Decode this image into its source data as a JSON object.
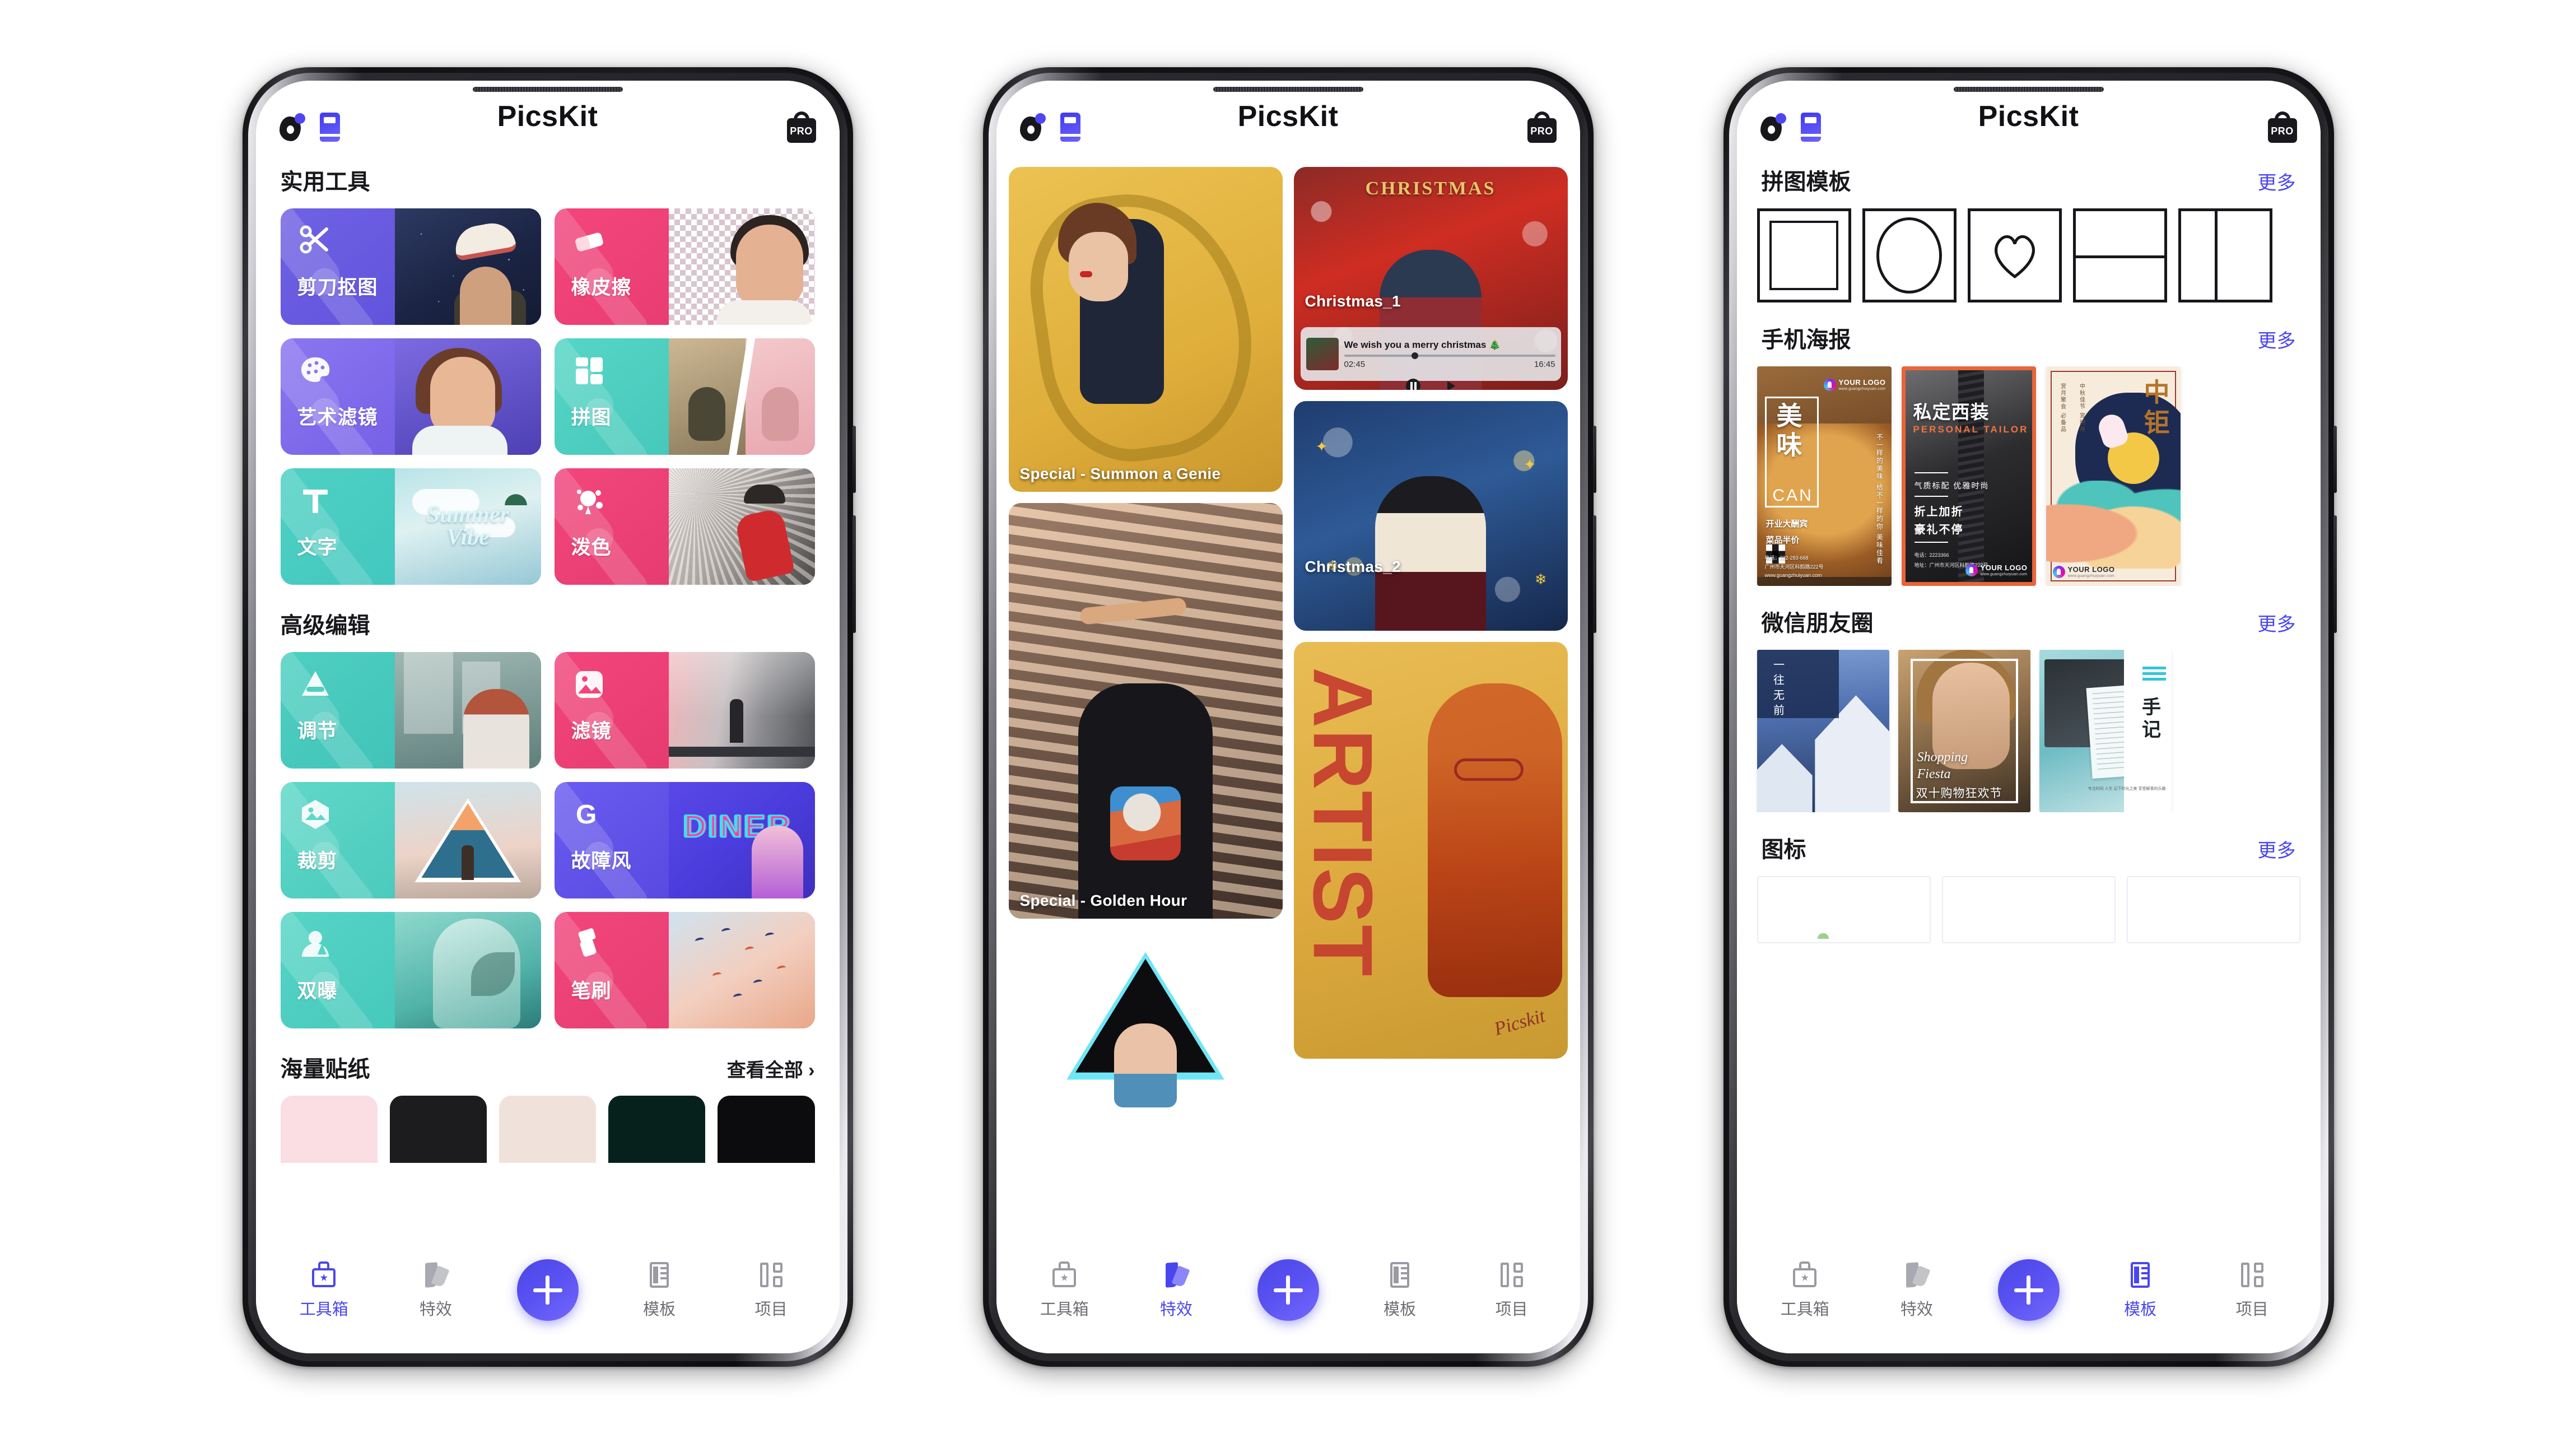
{
  "app": {
    "title": "PicsKit",
    "pro_badge": "PRO",
    "avatar_icon": "avatar-icon",
    "book_icon": "book-icon",
    "bag_icon": "pro-bag-icon"
  },
  "tabs": [
    {
      "label": "工具箱",
      "icon": "toolbox-icon"
    },
    {
      "label": "特效",
      "icon": "effects-icon"
    },
    {
      "label": "模板",
      "icon": "template-icon"
    },
    {
      "label": "项目",
      "icon": "project-icon"
    }
  ],
  "fab": {
    "icon": "plus-icon",
    "label": "+"
  },
  "colors": {
    "accent": "#4a46ef",
    "accent_light": "#7468fb",
    "pink": "#ef3f74",
    "teal": "#4ecdc0",
    "purple": "#7c6ae0",
    "text": "#18181c",
    "muted": "#6e6e76"
  },
  "phone1": {
    "active_tab": "工具箱",
    "sections": [
      {
        "title": "实用工具",
        "more": "",
        "cards": [
          {
            "label": "剪刀抠图",
            "icon": "scissors-icon",
            "theme": "purple"
          },
          {
            "label": "橡皮擦",
            "icon": "eraser-icon",
            "theme": "pink"
          },
          {
            "label": "艺术滤镜",
            "icon": "palette-icon",
            "theme": "purple"
          },
          {
            "label": "拼图",
            "icon": "grid-icon",
            "theme": "teal"
          },
          {
            "label": "文字",
            "icon": "text-t-icon",
            "theme": "teal"
          },
          {
            "label": "泼色",
            "icon": "splash-icon",
            "theme": "pink"
          }
        ]
      },
      {
        "title": "高级编辑",
        "more": "",
        "cards": [
          {
            "label": "调节",
            "icon": "adjust-icon",
            "theme": "teal"
          },
          {
            "label": "滤镜",
            "icon": "filter-icon",
            "theme": "pink"
          },
          {
            "label": "裁剪",
            "icon": "crop-icon",
            "theme": "teal"
          },
          {
            "label": "故障风",
            "icon": "glitch-g-icon",
            "theme": "indigo"
          },
          {
            "label": "双曝",
            "icon": "doubleexp-icon",
            "theme": "teal"
          },
          {
            "label": "笔刷",
            "icon": "brush-icon",
            "theme": "pink"
          }
        ]
      },
      {
        "title": "海量贴纸",
        "more": "查看全部 ›",
        "cards": []
      }
    ],
    "summer_vibe_line1": "Summer",
    "summer_vibe_line2": "Vibe",
    "glitch_neon_word": "DINER"
  },
  "phone2": {
    "active_tab": "特效",
    "cards": [
      {
        "caption": "Special - Summon a Genie",
        "col": 1
      },
      {
        "caption": "Christmas_1",
        "col": 2
      },
      {
        "caption": "Christmas_2",
        "col": 2
      },
      {
        "caption": "Special - Golden Hour",
        "col": 1
      },
      {
        "caption": "",
        "col": 1
      },
      {
        "caption": "",
        "col": 2
      }
    ],
    "christmas_banner": "CHRISTMAS",
    "player": {
      "track_title": "We wish you a merry christmas 🎄",
      "elapsed": "02:45",
      "duration": "16:45",
      "pause_icon": "pause-icon",
      "forward_icon": "fast-forward-icon"
    },
    "artist_word": "ARTIST",
    "artist_signature": "Picskit"
  },
  "phone3": {
    "active_tab": "模板",
    "sections": [
      {
        "title": "拼图模板",
        "more": "更多",
        "items": [
          {
            "shape": "rectangle"
          },
          {
            "shape": "oval"
          },
          {
            "shape": "heart"
          },
          {
            "shape": "h-split"
          },
          {
            "shape": "v-split"
          }
        ]
      },
      {
        "title": "手机海报",
        "more": "更多",
        "posters": [
          {
            "name": "food-poster",
            "headline": "美味",
            "sub": "CAN",
            "side_text": "不一样的美味 给不一样的你 美味佳肴",
            "promo_line1": "开业大酬宾",
            "promo_line2": "菜品半价",
            "logo": "YOUR LOGO",
            "logo_url": "www.guangzhuiyuan.com",
            "phone": "电话：222-283-668",
            "address": "广州市天河区科韵路222号",
            "site": "www.guangzhuiyuan.com"
          },
          {
            "name": "suit-poster",
            "headline": "私定西装",
            "sub": "PERSONAL  TAILOR",
            "tag": "气质标配 优雅时尚",
            "promo_line1": "折上加折",
            "promo_line2": "豪礼不停",
            "phone": "电话：2223366",
            "address": "地址：广州市天河区科韵路222号",
            "logo": "YOUR LOGO",
            "logo_url": "www.guangzhuiyuan.com"
          },
          {
            "name": "midautumn-poster",
            "headline": "中钜",
            "side_text_1": "中秋佳节 赏明月",
            "side_text_2": "赏月聚会 必备品",
            "logo": "YOUR LOGO",
            "logo_url": "www.guangzhuiyuan.com"
          }
        ]
      },
      {
        "title": "微信朋友圈",
        "more": "更多",
        "cards": [
          {
            "name": "house-card",
            "text": "一往无前"
          },
          {
            "name": "shopping-card",
            "line1": "Shopping",
            "line2": "Fiesta",
            "line3": "双十购物狂欢节"
          },
          {
            "name": "note-card",
            "text": "手记",
            "small": "专注时间 人生 记下时光之美 享受解事的乐趣"
          }
        ]
      },
      {
        "title": "图标",
        "more": "更多",
        "items": [
          {},
          {},
          {}
        ]
      }
    ]
  }
}
